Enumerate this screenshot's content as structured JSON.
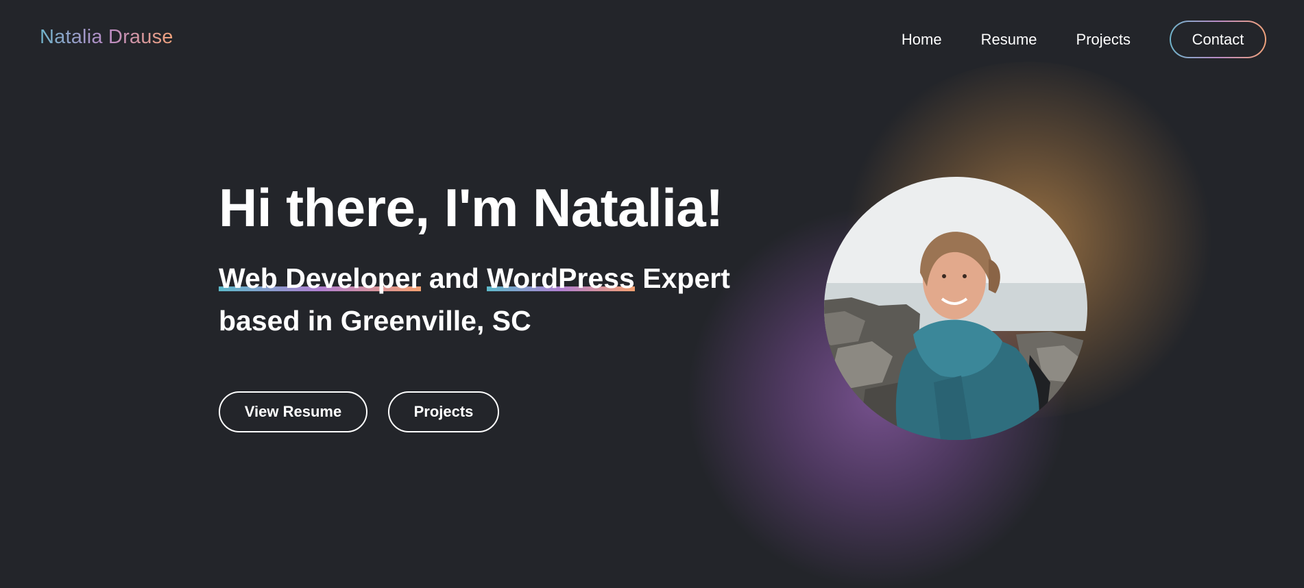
{
  "header": {
    "logo": "Natalia Drause",
    "nav": [
      "Home",
      "Resume",
      "Projects"
    ],
    "contact_label": "Contact"
  },
  "hero": {
    "title": "Hi there, I'm Natalia!",
    "sub_highlight_1": "Web Developer",
    "sub_and": " and ",
    "sub_highlight_2": "WordPress",
    "sub_rest_1": " Expert",
    "sub_rest_2": "based in Greenville, SC"
  },
  "buttons": {
    "resume": "View Resume",
    "projects": "Projects"
  },
  "colors": {
    "background": "#23252a",
    "gradient_start": "#6fb3c9",
    "gradient_mid": "#b98bc6",
    "gradient_end": "#f0a27a",
    "glow_purple": "#84589e",
    "glow_orange": "#b48248"
  }
}
